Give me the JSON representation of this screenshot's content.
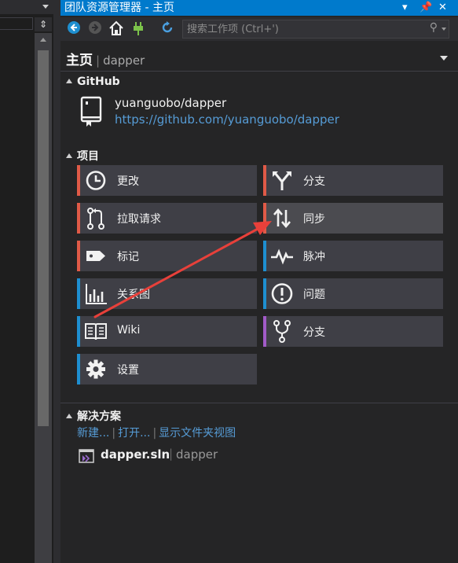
{
  "window": {
    "title": "团队资源管理器 - 主页"
  },
  "toolbar": {
    "search_placeholder": "搜索工作项 (Ctrl+')"
  },
  "header": {
    "title": "主页",
    "separator": "|",
    "subtitle": "dapper"
  },
  "github": {
    "section_title": "GitHub",
    "repo_name": "yuanguobo/dapper",
    "repo_url": "https://github.com/yuanguobo/dapper"
  },
  "project": {
    "section_title": "项目",
    "tiles": [
      {
        "label": "更改",
        "color": "#e05a47",
        "icon": "clock-icon"
      },
      {
        "label": "分支",
        "color": "#e05a47",
        "icon": "branch-merge-icon"
      },
      {
        "label": "拉取请求",
        "color": "#e05a47",
        "icon": "pull-request-icon"
      },
      {
        "label": "同步",
        "color": "#e05a47",
        "icon": "sync-arrows-icon"
      },
      {
        "label": "标记",
        "color": "#e05a47",
        "icon": "tag-icon"
      },
      {
        "label": "脉冲",
        "color": "#1e8fd0",
        "icon": "pulse-icon"
      },
      {
        "label": "关系图",
        "color": "#1e8fd0",
        "icon": "graph-icon"
      },
      {
        "label": "问题",
        "color": "#1e8fd0",
        "icon": "issue-icon"
      },
      {
        "label": "Wiki",
        "color": "#1e8fd0",
        "icon": "book-icon"
      },
      {
        "label": "分支",
        "color": "#a15bc7",
        "icon": "fork-icon"
      },
      {
        "label": "设置",
        "color": "#1e8fd0",
        "icon": "gear-icon"
      }
    ]
  },
  "solutions": {
    "section_title": "解决方案",
    "links": {
      "new": "新建...",
      "open": "打开...",
      "folder_view": "显示文件夹视图",
      "sep": "|"
    },
    "item": {
      "name": "dapper.sln",
      "separator": "|",
      "project": "dapper"
    }
  },
  "colors": {
    "accent": "#007acc",
    "link": "#569cd6",
    "annotation_arrow": "#e8403a"
  }
}
